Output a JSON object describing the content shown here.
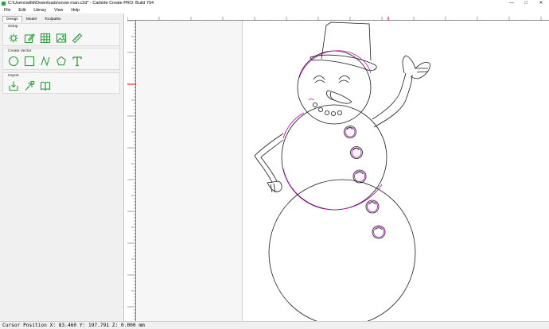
{
  "window": {
    "title": "C:\\Users\\willd\\Downloads\\snow man.c2d* - Carbide Create PRO: Build 764",
    "controls": {
      "minimize": "—",
      "maximize": "□",
      "close": "✕"
    }
  },
  "menu": [
    "File",
    "Edit",
    "Library",
    "View",
    "Help"
  ],
  "tabs": [
    {
      "label": "Design",
      "active": true
    },
    {
      "label": "Model",
      "active": false
    },
    {
      "label": "Toolpaths",
      "active": false
    }
  ],
  "panels": {
    "setup": {
      "title": "Setup",
      "tools": [
        "job-setup-icon",
        "edit-icon",
        "grid-icon",
        "image-icon",
        "ruler-icon"
      ]
    },
    "create_vector": {
      "title": "Create Vector",
      "tools": [
        "circle-icon",
        "rectangle-icon",
        "curve-icon",
        "polygon-icon",
        "text-icon"
      ]
    },
    "import": {
      "title": "Import",
      "tools": [
        "import-icon",
        "import-vector-icon",
        "library-icon"
      ]
    }
  },
  "accent_color": "#2f9e3f",
  "selection_color": "#c000c0",
  "status": "Cursor Position X: 83.460 Y: 197.791 Z: 0.000 mm"
}
